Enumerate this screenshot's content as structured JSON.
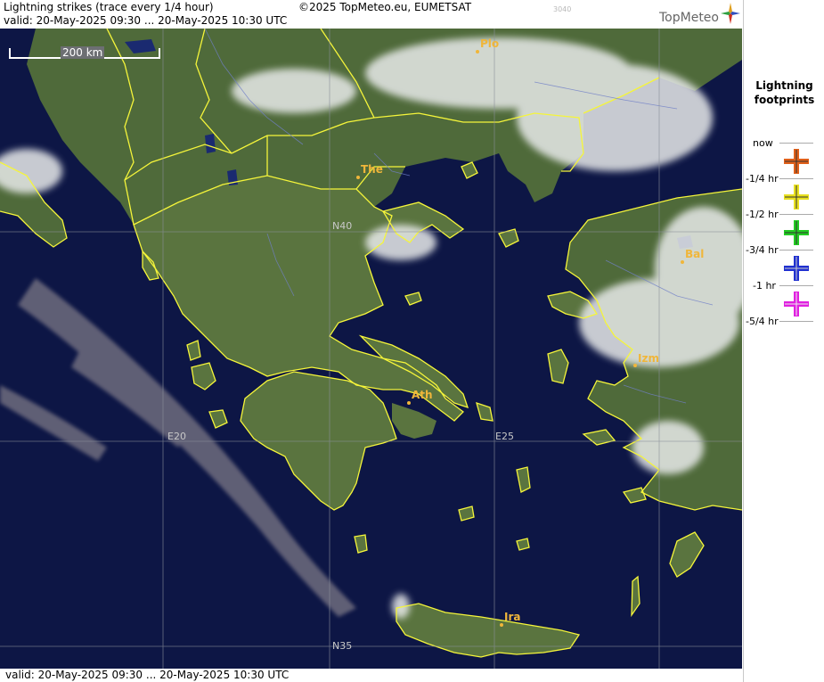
{
  "header": {
    "title": "Lightning strikes (trace every 1/4 hour)",
    "valid": "valid:  20-May-2025 09:30 ... 20-May-2025 10:30 UTC",
    "copyright": "©2025 TopMeteo.eu, EUMETSAT",
    "image_id": "3040",
    "brand": "TopMeteo"
  },
  "map": {
    "scale_label": "200 km",
    "grid_labels": {
      "n40": "N40",
      "n35": "N35",
      "e20": "E20",
      "e25": "E25"
    },
    "cities": {
      "plo": "Plo",
      "the": "The",
      "ath": "Ath",
      "izm": "Izm",
      "bal": "Bal",
      "ira": "Ira"
    },
    "colors": {
      "sea": "#0d1645",
      "land": "#4f6a3a",
      "border": "#f5f53a",
      "city": "#f0b63a"
    }
  },
  "footer": {
    "valid": "valid:  20-May-2025 09:30 ... 20-May-2025 10:30 UTC"
  },
  "legend": {
    "title_line1": "Lightning",
    "title_line2": "footprints",
    "items": [
      {
        "label": "now",
        "color": ""
      },
      {
        "label": "-1/4 hr",
        "color": "#e0601a"
      },
      {
        "label": "-1/2 hr",
        "color": "#e8e020"
      },
      {
        "label": "-3/4 hr",
        "color": "#22cc22"
      },
      {
        "label": "-1 hr",
        "color": "#2030d0"
      },
      {
        "label": "-5/4 hr",
        "color": "#e020e0"
      }
    ]
  }
}
